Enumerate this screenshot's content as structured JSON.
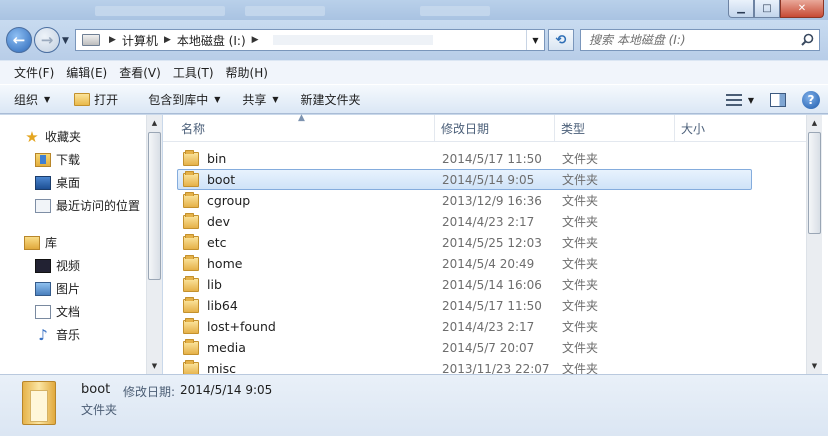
{
  "window": {
    "controls": {
      "minimize": "▁",
      "maximize": "□",
      "close": "✕"
    }
  },
  "nav": {
    "back_icon": "back-arrow-icon",
    "forward_icon": "forward-arrow-icon",
    "breadcrumb": [
      "计算机",
      "本地磁盘 (I:)"
    ],
    "search_placeholder": "搜索 本地磁盘 (I:)"
  },
  "menu": [
    "文件(F)",
    "编辑(E)",
    "查看(V)",
    "工具(T)",
    "帮助(H)"
  ],
  "toolbar": {
    "organize": "组织",
    "open": "打开",
    "include_library": "包含到库中",
    "share": "共享",
    "new_folder": "新建文件夹"
  },
  "sidebar": {
    "favorites": {
      "label": "收藏夹",
      "items": [
        {
          "label": "下载",
          "icon": "download-folder-icon"
        },
        {
          "label": "桌面",
          "icon": "desktop-icon"
        },
        {
          "label": "最近访问的位置",
          "icon": "recent-places-icon"
        }
      ]
    },
    "libraries": {
      "label": "库",
      "items": [
        {
          "label": "视频",
          "icon": "video-library-icon"
        },
        {
          "label": "图片",
          "icon": "picture-library-icon"
        },
        {
          "label": "文档",
          "icon": "document-library-icon"
        },
        {
          "label": "音乐",
          "icon": "music-library-icon"
        }
      ]
    }
  },
  "columns": {
    "name": "名称",
    "modified": "修改日期",
    "type": "类型",
    "size": "大小"
  },
  "files": [
    {
      "name": "bin",
      "modified": "2014/5/17 11:50",
      "type": "文件夹",
      "selected": false
    },
    {
      "name": "boot",
      "modified": "2014/5/14 9:05",
      "type": "文件夹",
      "selected": true
    },
    {
      "name": "cgroup",
      "modified": "2013/12/9 16:36",
      "type": "文件夹",
      "selected": false
    },
    {
      "name": "dev",
      "modified": "2014/4/23 2:17",
      "type": "文件夹",
      "selected": false
    },
    {
      "name": "etc",
      "modified": "2014/5/25 12:03",
      "type": "文件夹",
      "selected": false
    },
    {
      "name": "home",
      "modified": "2014/5/4 20:49",
      "type": "文件夹",
      "selected": false
    },
    {
      "name": "lib",
      "modified": "2014/5/14 16:06",
      "type": "文件夹",
      "selected": false
    },
    {
      "name": "lib64",
      "modified": "2014/5/17 11:50",
      "type": "文件夹",
      "selected": false
    },
    {
      "name": "lost+found",
      "modified": "2014/4/23 2:17",
      "type": "文件夹",
      "selected": false
    },
    {
      "name": "media",
      "modified": "2014/5/7 20:07",
      "type": "文件夹",
      "selected": false
    },
    {
      "name": "misc",
      "modified": "2013/11/23 22:07",
      "type": "文件夹",
      "selected": false
    }
  ],
  "details": {
    "name": "boot",
    "modified_label": "修改日期:",
    "modified_value": "2014/5/14 9:05",
    "type": "文件夹"
  }
}
